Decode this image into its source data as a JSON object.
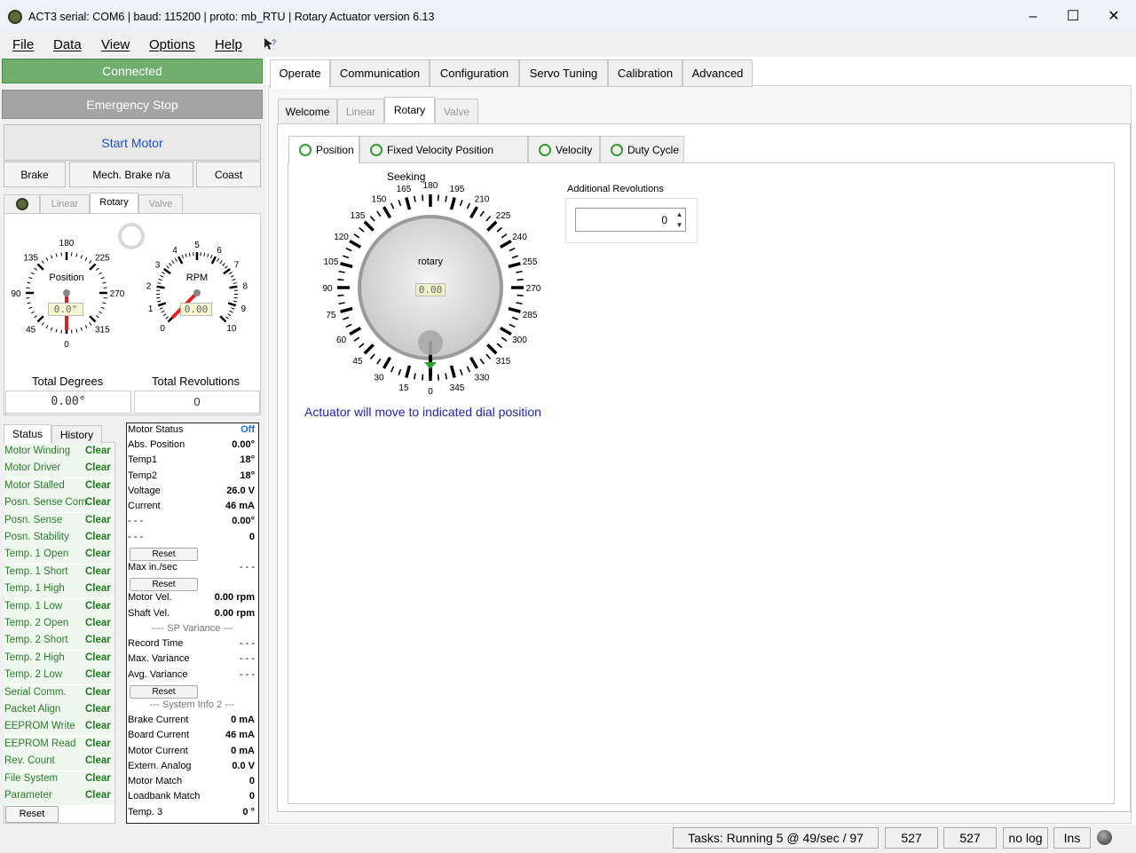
{
  "titlebar": {
    "title": "ACT3  serial: COM6  |  baud: 115200  |  proto: mb_RTU  |  Rotary Actuator version 6.13"
  },
  "menu": [
    "File",
    "Data",
    "View",
    "Options",
    "Help"
  ],
  "left": {
    "connected": "Connected",
    "estop": "Emergency Stop",
    "start_motor": "Start Motor",
    "brake": "Brake",
    "mech_brake": "Mech. Brake n/a",
    "coast": "Coast",
    "tabs": [
      "Linear",
      "Rotary",
      "Valve"
    ],
    "position_gauge": {
      "title": "Position",
      "readout": "0.0°",
      "ticks": [
        "180",
        "135",
        "225",
        "90",
        "270",
        "45",
        "315",
        "0"
      ],
      "value_deg": 0
    },
    "rpm_gauge": {
      "title": "RPM",
      "readout": "0.00",
      "ticks": [
        "0",
        "1",
        "2",
        "3",
        "4",
        "5",
        "6",
        "7",
        "8",
        "9",
        "10"
      ],
      "value": 0
    },
    "total_degrees_label": "Total Degrees",
    "total_degrees": "0.00°",
    "total_revs_label": "Total Revolutions",
    "total_revs": "0",
    "status_tabs": [
      "Status",
      "History"
    ],
    "status_rows": [
      {
        "label": "Motor Winding",
        "value": "Clear"
      },
      {
        "label": "Motor Driver",
        "value": "Clear"
      },
      {
        "label": "Motor Stalled",
        "value": "Clear"
      },
      {
        "label": "Posn. Sense Com",
        "value": "Clear"
      },
      {
        "label": "Posn. Sense",
        "value": "Clear"
      },
      {
        "label": "Posn. Stability",
        "value": "Clear"
      },
      {
        "label": "Temp. 1 Open",
        "value": "Clear"
      },
      {
        "label": "Temp. 1 Short",
        "value": "Clear"
      },
      {
        "label": "Temp. 1 High",
        "value": "Clear"
      },
      {
        "label": "Temp. 1 Low",
        "value": "Clear"
      },
      {
        "label": "Temp. 2 Open",
        "value": "Clear"
      },
      {
        "label": "Temp. 2 Short",
        "value": "Clear"
      },
      {
        "label": "Temp. 2 High",
        "value": "Clear"
      },
      {
        "label": "Temp. 2 Low",
        "value": "Clear"
      },
      {
        "label": "Serial Comm.",
        "value": "Clear"
      },
      {
        "label": "Packet Align",
        "value": "Clear"
      },
      {
        "label": "EEPROM Write",
        "value": "Clear"
      },
      {
        "label": "EEPROM Read",
        "value": "Clear"
      },
      {
        "label": "Rev. Count",
        "value": "Clear"
      },
      {
        "label": "File System",
        "value": "Clear"
      },
      {
        "label": "Parameter",
        "value": "Clear"
      }
    ],
    "status_reset": "Reset",
    "motor_rows": [
      {
        "label": "Motor Status",
        "value": "Off",
        "kind": "row",
        "blue": true
      },
      {
        "label": "Abs. Position",
        "value": "0.00°",
        "kind": "row"
      },
      {
        "label": "Temp1",
        "value": "18°",
        "kind": "row"
      },
      {
        "label": "Temp2",
        "value": "18°",
        "kind": "row"
      },
      {
        "label": "Voltage",
        "value": "26.0 V",
        "kind": "row"
      },
      {
        "label": "Current",
        "value": "46 mA",
        "kind": "row"
      },
      {
        "label": "- - -",
        "value": "0.00°",
        "kind": "row"
      },
      {
        "label": "- - -",
        "value": "0",
        "kind": "row"
      },
      {
        "label": "Reset",
        "value": "",
        "kind": "button"
      },
      {
        "label": "Max in./sec",
        "value": "- - -",
        "kind": "row",
        "plain": true
      },
      {
        "label": "Reset",
        "value": "",
        "kind": "button"
      },
      {
        "label": "Motor Vel.",
        "value": "0.00 rpm",
        "kind": "row"
      },
      {
        "label": "Shaft Vel.",
        "value": "0.00 rpm",
        "kind": "row"
      },
      {
        "label": "---- SP Variance ---",
        "value": "",
        "kind": "header"
      },
      {
        "label": "Record Time",
        "value": "- - -",
        "kind": "row",
        "plain": true
      },
      {
        "label": "Max. Variance",
        "value": "- - -",
        "kind": "row",
        "plain": true
      },
      {
        "label": "Avg. Variance",
        "value": "- - -",
        "kind": "row",
        "plain": true
      },
      {
        "label": "Reset",
        "value": "",
        "kind": "button"
      },
      {
        "label": "--- System Info 2 ---",
        "value": "",
        "kind": "header"
      },
      {
        "label": "Brake Current",
        "value": "0 mA",
        "kind": "row"
      },
      {
        "label": "Board Current",
        "value": "46 mA",
        "kind": "row"
      },
      {
        "label": "Motor Current",
        "value": "0 mA",
        "kind": "row"
      },
      {
        "label": "Extern. Analog",
        "value": "0.0 V",
        "kind": "row"
      },
      {
        "label": "Motor Match",
        "value": "0",
        "kind": "row"
      },
      {
        "label": "Loadbank Match",
        "value": "0",
        "kind": "row"
      },
      {
        "label": "Temp. 3",
        "value": "0 °",
        "kind": "row"
      }
    ]
  },
  "right": {
    "top_tabs": [
      "Operate",
      "Communication",
      "Configuration",
      "Servo Tuning",
      "Calibration",
      "Advanced"
    ],
    "sub_tabs": [
      "Welcome",
      "Linear",
      "Rotary",
      "Valve"
    ],
    "mode_tabs": [
      "Position",
      "Fixed Velocity Position Seeking",
      "Velocity",
      "Duty Cycle"
    ],
    "dial": {
      "label": "rotary",
      "readout": "0.00",
      "value_deg": 0,
      "ticks": [
        "0",
        "15",
        "30",
        "45",
        "60",
        "75",
        "90",
        "105",
        "120",
        "135",
        "150",
        "165",
        "180",
        "195",
        "210",
        "225",
        "240",
        "255",
        "270",
        "285",
        "300",
        "315",
        "330",
        "345"
      ]
    },
    "additional_revolutions_label": "Additional Revolutions",
    "additional_revolutions": "0",
    "dial_note": "Actuator will move to indicated dial position"
  },
  "statusbar": {
    "tasks": "Tasks: Running 5 @ 49/sec / 97",
    "count1": "527",
    "count2": "527",
    "log": "no log",
    "ins": "Ins"
  }
}
